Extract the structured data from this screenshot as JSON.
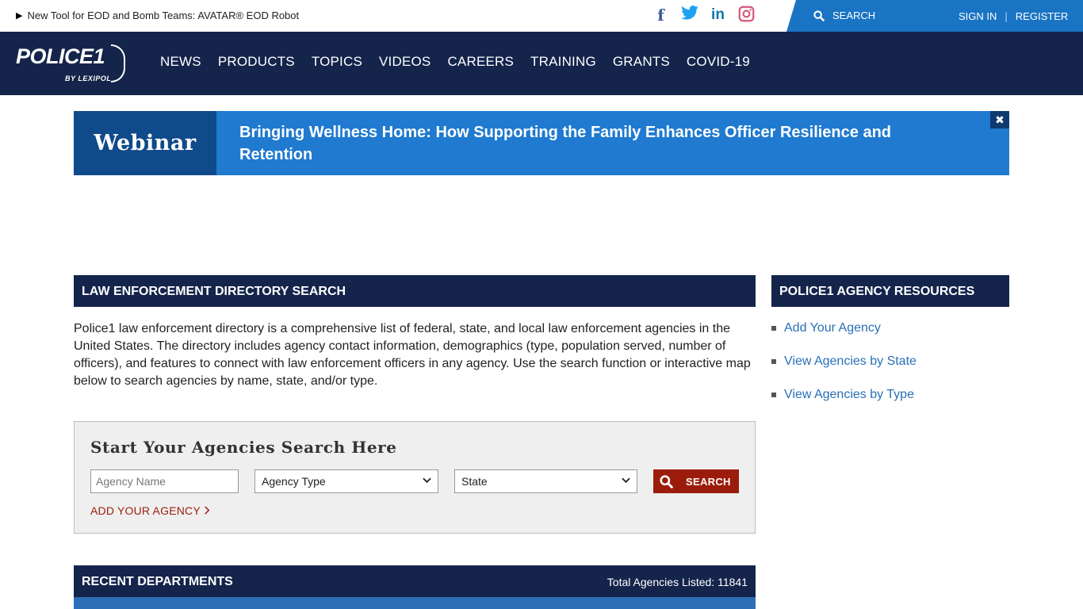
{
  "topbar": {
    "promo_text": "New Tool for EOD and Bomb Teams: AVATAR® EOD Robot",
    "search_label": "SEARCH",
    "sign_in": "SIGN IN",
    "register": "REGISTER"
  },
  "social": {
    "facebook": "f",
    "twitter": "t",
    "linkedin": "in",
    "instagram": "◎"
  },
  "logo": {
    "word": "POLICE1",
    "sub": "BY LEXIPOL"
  },
  "nav": [
    "NEWS",
    "PRODUCTS",
    "TOPICS",
    "VIDEOS",
    "CAREERS",
    "TRAINING",
    "GRANTS",
    "COVID-19"
  ],
  "banner": {
    "label": "Webinar",
    "title": "Bringing Wellness Home: How Supporting the Family Enhances Officer Resilience and Retention",
    "close": "✖"
  },
  "directory": {
    "heading": "LAW ENFORCEMENT DIRECTORY SEARCH",
    "description": "Police1 law enforcement directory is a comprehensive list of federal, state, and local law enforcement agencies in the United States. The directory includes agency contact information, demographics (type, population served, number of officers), and features to connect with law enforcement officers in any agency. Use the search function or interactive map below to search agencies by name, state, and/or type."
  },
  "resources": {
    "heading": "POLICE1 AGENCY RESOURCES",
    "links": [
      "Add Your Agency",
      "View Agencies by State",
      "View Agencies by Type"
    ]
  },
  "search": {
    "heading": "Start Your Agencies Search Here",
    "name_placeholder": "Agency Name",
    "type_selected": "Agency Type",
    "state_selected": "State",
    "button": "SEARCH",
    "add_agency": "ADD YOUR AGENCY"
  },
  "recent": {
    "heading": "RECENT DEPARTMENTS",
    "total": "Total Agencies Listed: 11841"
  },
  "colors": {
    "navy": "#14244b",
    "blue": "#1f7ad0",
    "red": "#9c1c0b",
    "link": "#2a6fb8"
  }
}
